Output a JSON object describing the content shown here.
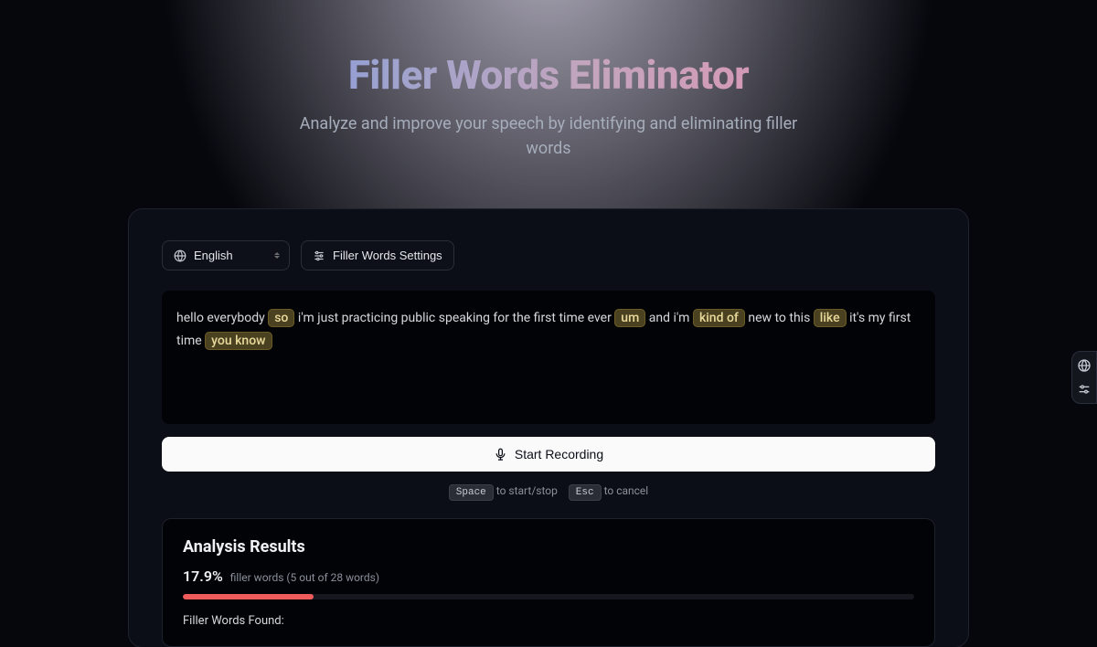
{
  "header": {
    "title": "Filler Words Eliminator",
    "subtitle": "Analyze and improve your speech by identifying and eliminating filler words"
  },
  "controls": {
    "language": "English",
    "settings_label": "Filler Words Settings"
  },
  "transcript": {
    "segments": [
      {
        "text": "hello everybody ",
        "filler": false
      },
      {
        "text": "so",
        "filler": true
      },
      {
        "text": " i'm just practicing public speaking for the first time ever ",
        "filler": false
      },
      {
        "text": "um",
        "filler": true
      },
      {
        "text": " and i'm ",
        "filler": false
      },
      {
        "text": "kind of",
        "filler": true
      },
      {
        "text": " new to this ",
        "filler": false
      },
      {
        "text": "like",
        "filler": true
      },
      {
        "text": " it's my first time ",
        "filler": false
      },
      {
        "text": "you know",
        "filler": true
      }
    ]
  },
  "record_button": "Start Recording",
  "shortcuts": {
    "space_key": "Space",
    "space_label": " to start/stop",
    "esc_key": "Esc",
    "esc_label": " to cancel"
  },
  "results": {
    "title": "Analysis Results",
    "percentage": "17.9%",
    "summary": "filler words (5 out of 28 words)",
    "progress_percent": 17.9,
    "found_label": "Filler Words Found:"
  }
}
